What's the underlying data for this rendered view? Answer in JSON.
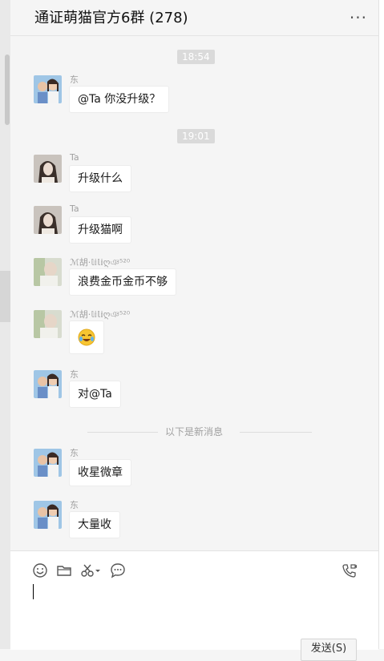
{
  "header": {
    "title": "通证萌猫官方6群 (278)",
    "more_icon": "more-horizontal-icon"
  },
  "timestamps": [
    "18:54",
    "19:01"
  ],
  "messages": [
    {
      "sender": "东",
      "text": "@Ta 你没升级？",
      "avatar": "couple-photo"
    },
    {
      "sender": "Ta",
      "text": "升级什么",
      "avatar": "girl-photo"
    },
    {
      "sender": "Ta",
      "text": "升级猫啊",
      "avatar": "girl-photo"
    },
    {
      "sender": "ℳ胡·𝕝𝕚𝕝𝕚ღঞ⁵²⁰",
      "text": "浪费金币金币不够",
      "avatar": "blurry-photo"
    },
    {
      "sender": "ℳ胡·𝕝𝕚𝕝𝕚ღঞ⁵²⁰",
      "text": "",
      "emoji": "😭",
      "avatar": "blurry-photo"
    },
    {
      "sender": "东",
      "text": "对@Ta",
      "avatar": "couple-photo"
    },
    {
      "sender": "东",
      "text": "收星微章",
      "avatar": "couple-photo"
    },
    {
      "sender": "东",
      "text": "大量收",
      "avatar": "couple-photo"
    }
  ],
  "new_messages_divider": "以下是新消息",
  "toolbar": {
    "icons": [
      "emoji-icon",
      "folder-icon",
      "screenshot-scissors-icon",
      "chat-history-icon",
      "voice-video-call-icon"
    ]
  },
  "input": {
    "value": ""
  },
  "send_button": {
    "label": "发送(S)"
  }
}
